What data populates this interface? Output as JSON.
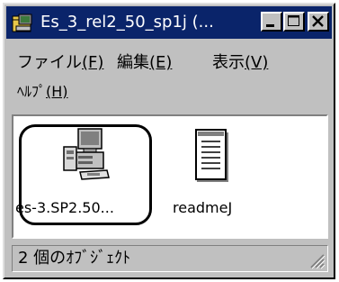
{
  "window": {
    "title": "Es_3_rel2_50_sp1j (..."
  },
  "menu": {
    "file_label": "ファイル",
    "file_key": "(F)",
    "edit_label": "編集",
    "edit_key": "(E)",
    "view_label": "表示",
    "view_key": "(V)",
    "help_label": "ﾍﾙﾌﾟ",
    "help_key": "(H)"
  },
  "files": [
    {
      "name": "es-3.SP2.50...",
      "icon": "setup-computer-icon",
      "selected": true
    },
    {
      "name": "readmeJ",
      "icon": "text-document-icon",
      "selected": false
    }
  ],
  "status": {
    "text": "2 個のｵﾌﾞｼﾞｪｸﾄ"
  },
  "colors": {
    "titlebar": "#0a246a",
    "chrome": "#c0c0c0",
    "content": "#ffffff"
  }
}
